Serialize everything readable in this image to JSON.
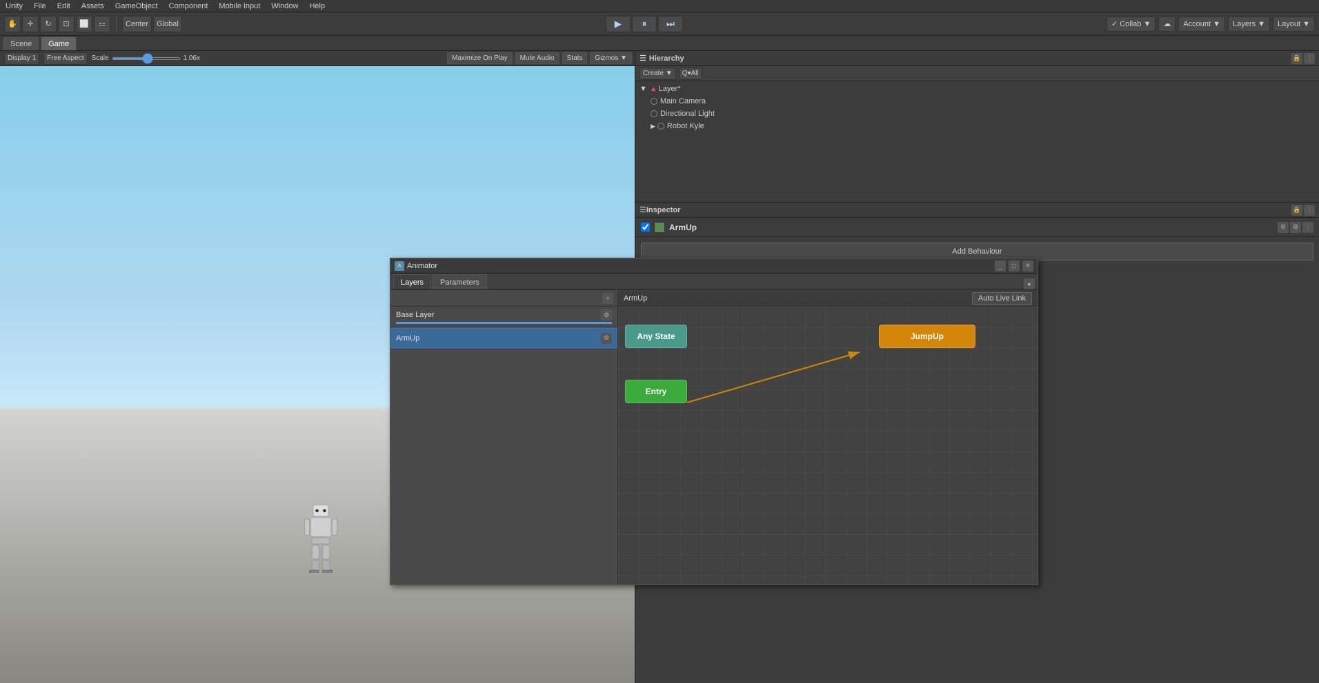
{
  "menubar": {
    "items": [
      "File",
      "Edit",
      "Assets",
      "GameObject",
      "Component",
      "Mobile Input",
      "Window",
      "Help"
    ]
  },
  "toolbar": {
    "pivot_label": "Center",
    "space_label": "Global",
    "collab_label": "Collab ▼",
    "account_label": "Account ▼",
    "layers_label": "Layers ▼",
    "layout_label": "Layout ▼",
    "cloud_icon": "☁"
  },
  "viewport": {
    "scene_tab": "Scene",
    "game_tab": "Game",
    "active_tab": "game",
    "display_label": "Display 1",
    "aspect_label": "Free Aspect",
    "scale_label": "Scale",
    "scale_value": "1.06x",
    "maximize_label": "Maximize On Play",
    "mute_label": "Mute Audio",
    "stats_label": "Stats",
    "gizmos_label": "Gizmos ▼"
  },
  "hierarchy": {
    "title": "Hierarchy",
    "create_label": "Create ▼",
    "search_placeholder": "Q▾All",
    "items": [
      {
        "name": "Layer*",
        "level": 0,
        "type": "scene",
        "expanded": true
      },
      {
        "name": "Main Camera",
        "level": 1,
        "type": "camera"
      },
      {
        "name": "Directional Light",
        "level": 1,
        "type": "light"
      },
      {
        "name": "Robot Kyle",
        "level": 1,
        "type": "object",
        "expanded": false
      }
    ]
  },
  "inspector": {
    "title": "Inspector",
    "object_name": "ArmUp",
    "object_color": "#5a8a5a",
    "add_behaviour_label": "Add Behaviour"
  },
  "animator": {
    "title": "Animator",
    "tabs": [
      "Layers",
      "Parameters"
    ],
    "active_tab": "Layers",
    "eye_icon": "👁",
    "plus_icon": "+",
    "graph_title": "ArmUp",
    "auto_live_link_label": "Auto Live Link",
    "layers": [
      {
        "name": "Base Layer",
        "has_bar": true
      },
      {
        "name": "ArmUp",
        "selected": true
      }
    ],
    "states": [
      {
        "name": "Any State",
        "type": "any-state"
      },
      {
        "name": "Entry",
        "type": "entry"
      },
      {
        "name": "JumpUp",
        "type": "jump-up"
      }
    ]
  },
  "icons": {
    "play": "▶",
    "pause": "⏸",
    "step": "⏭",
    "gear": "⚙",
    "close": "✕",
    "arrow_right": "▶",
    "arrow_down": "▼",
    "lock": "🔒",
    "dots": "⋮"
  }
}
